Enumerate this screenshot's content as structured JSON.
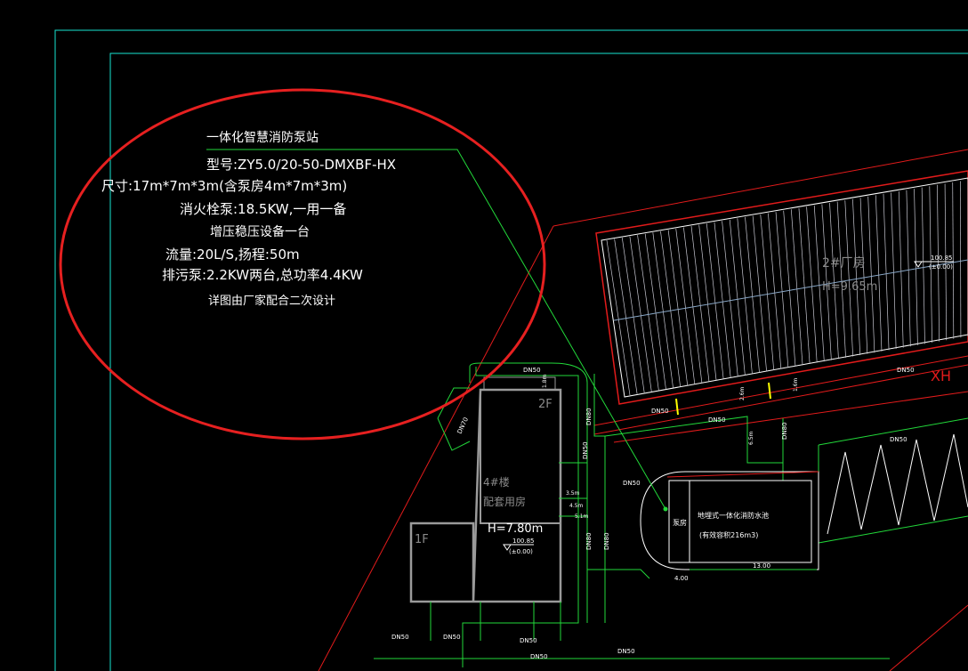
{
  "annotation": {
    "title": "一体化智慧消防泵站",
    "lines": [
      "型号:ZY5.0/20-50-DMXBF-HX",
      "尺寸:17m*7m*3m(含泵房4m*7m*3m)",
      "消火栓泵:18.5KW,一用一备",
      "增压稳压设备一台",
      "流量:20L/S,扬程:50m",
      "排污泵:2.2KW两台,总功率4.4KW",
      "详图由厂家配合二次设计"
    ]
  },
  "building_2": {
    "name": "2#厂房",
    "height": "H=9.65m",
    "elev_top": "100.85",
    "elev_bottom": "(±0.00)",
    "side_label": "XH"
  },
  "building_4": {
    "name": "4#楼",
    "use": "配套用房",
    "height": "H=7.80m",
    "floor_upper": "2F",
    "floor_lower": "1F",
    "elev_top": "100.85",
    "elev_bottom": "(±0.00)"
  },
  "pump_station": {
    "room_label": "泵房",
    "title": "地埋式一体化消防水池",
    "capacity": "(有效容积216m3)",
    "dim_width": "13.00",
    "dim_left": "4.00"
  },
  "pipes": {
    "dn50": "DN50",
    "dn80": "DN80",
    "dn70": "DN70"
  },
  "dims": {
    "d1": "1.8m",
    "d2": "2.6m",
    "d3": "6.5m",
    "d4": "3.5m",
    "d5": "4.5m",
    "d6": "5.1m",
    "d7": "1.6m"
  },
  "colors": {
    "background": "#000000",
    "frame": "#19e6d2",
    "highlight_circle": "#e62020",
    "red_lines": "#e21b1b",
    "green_pipes": "#22d83a",
    "white_lines": "#ffffff",
    "building_gray": "#9a9a9a",
    "hatch": "#c8c8d2",
    "accent_yellow": "#ffff00"
  }
}
